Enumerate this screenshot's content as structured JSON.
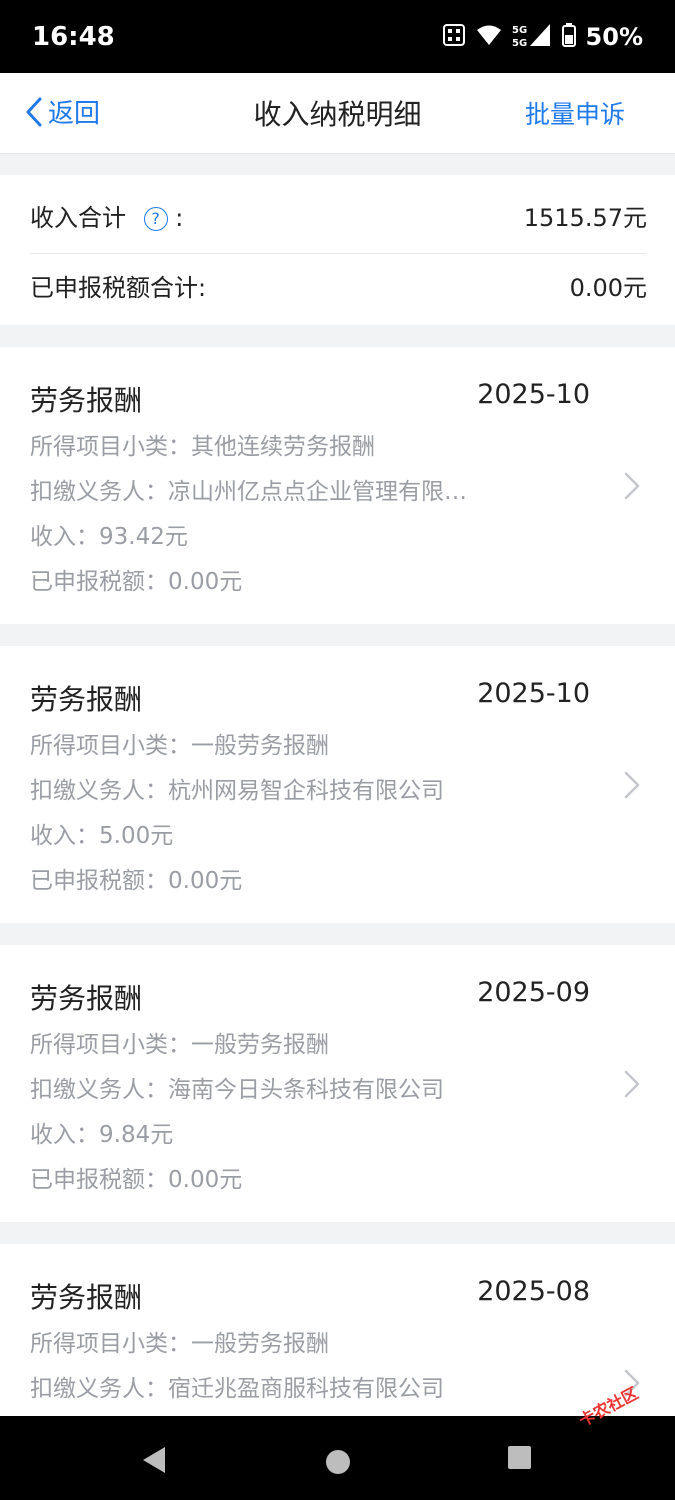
{
  "status_bar": {
    "time": "16:48",
    "battery": "50%",
    "network": "5G"
  },
  "nav": {
    "back_label": "返回",
    "title": "收入纳税明细",
    "action_label": "批量申诉"
  },
  "summary": {
    "income_label": "收入合计",
    "income_colon": ":",
    "income_value": "1515.57元",
    "tax_label": "已申报税额合计:",
    "tax_value": "0.00元"
  },
  "records": [
    {
      "title": "劳务报酬",
      "date": "2025-10",
      "subcategory": "所得项目小类：其他连续劳务报酬",
      "withholder": "扣缴义务人：凉山州亿点点企业管理有限…",
      "income": "收入：93.42元",
      "tax": "已申报税额：0.00元"
    },
    {
      "title": "劳务报酬",
      "date": "2025-10",
      "subcategory": "所得项目小类：一般劳务报酬",
      "withholder": "扣缴义务人：杭州网易智企科技有限公司",
      "income": "收入：5.00元",
      "tax": "已申报税额：0.00元"
    },
    {
      "title": "劳务报酬",
      "date": "2025-09",
      "subcategory": "所得项目小类：一般劳务报酬",
      "withholder": "扣缴义务人：海南今日头条科技有限公司",
      "income": "收入：9.84元",
      "tax": "已申报税额：0.00元"
    },
    {
      "title": "劳务报酬",
      "date": "2025-08",
      "subcategory": "所得项目小类：一般劳务报酬",
      "withholder": "扣缴义务人：宿迁兆盈商服科技有限公司",
      "income": "",
      "tax": ""
    }
  ],
  "watermark": "卡农社区",
  "colors": {
    "accent": "#1f7aea",
    "page_bg": "#f2f3f5",
    "secondary_text": "#9a9ea4"
  }
}
